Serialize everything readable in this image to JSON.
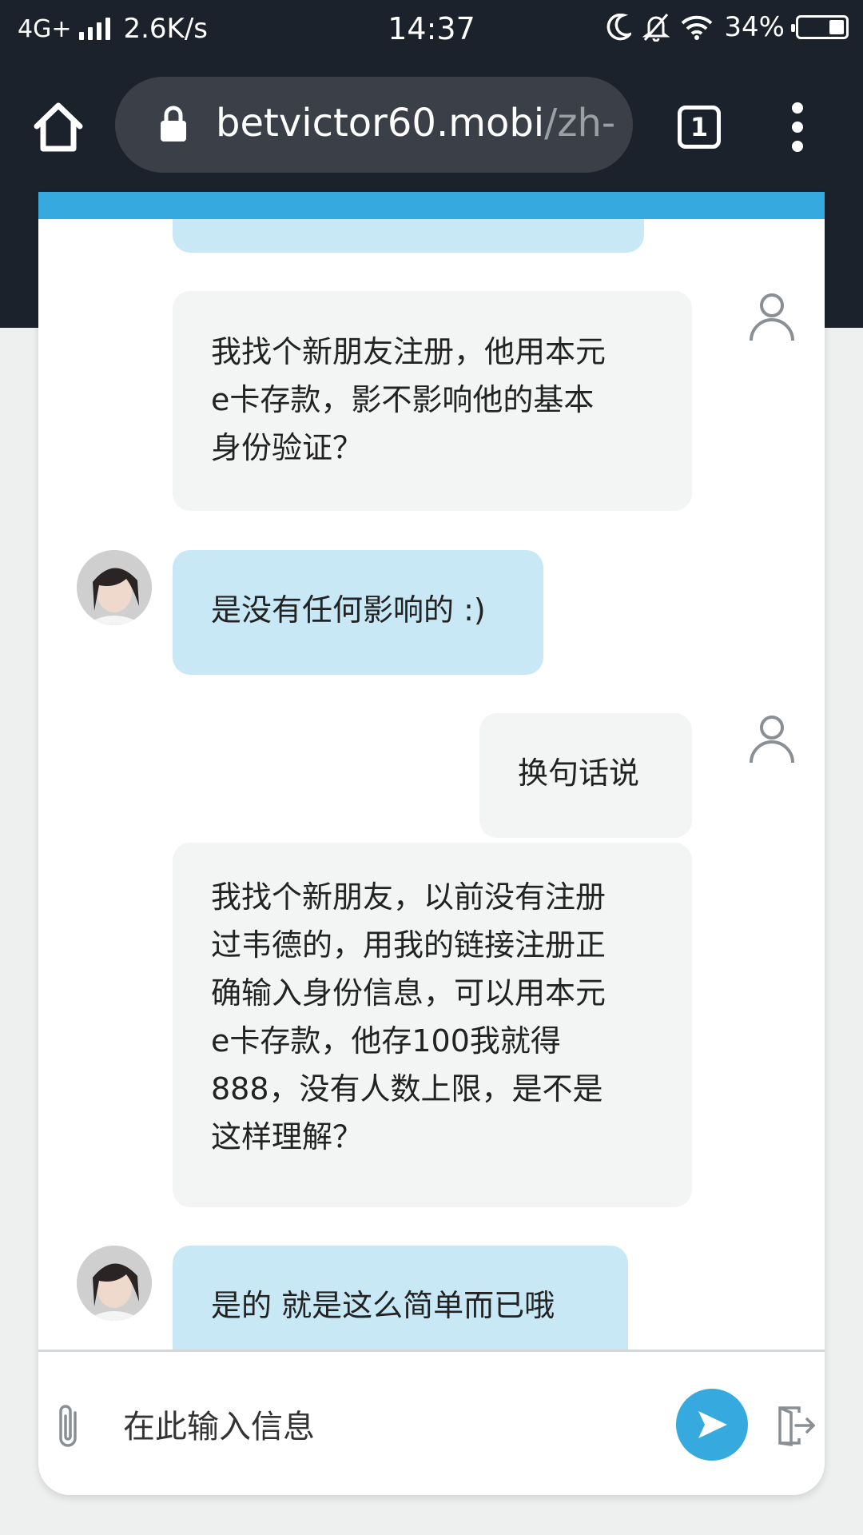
{
  "status_bar": {
    "network": "4G+",
    "speed": "2.6K/s",
    "time": "14:37",
    "battery": "34%"
  },
  "browser": {
    "url_domain": "betvictor60.mobi",
    "url_path": "/zh-c",
    "tab_count": "1"
  },
  "chat": {
    "messages": [
      {
        "sender": "user",
        "text_lines": [
          "我找个新朋友注册，他用本元",
          "e卡存款，影不影响他的基本",
          "身份验证？"
        ]
      },
      {
        "sender": "agent",
        "text_lines": [
          "是没有任何影响的 :)"
        ]
      },
      {
        "sender": "user",
        "text_lines": [
          "换句话说"
        ]
      },
      {
        "sender": "user",
        "text_lines": [
          "我找个新朋友，以前没有注册",
          "过韦德的，用我的链接注册正",
          "确输入身份信息，可以用本元",
          "e卡存款，他存100我就得",
          "888，没有人数上限，是不是",
          "这样理解？"
        ]
      },
      {
        "sender": "agent",
        "text_lines": [
          "是的 就是这么简单而已哦"
        ]
      }
    ],
    "input_placeholder": "在此输入信息"
  },
  "colors": {
    "agent_bubble": "#c8e8f6",
    "user_bubble": "#f3f4f4",
    "accent": "#36aadf",
    "browser_bar": "#1c222b"
  }
}
